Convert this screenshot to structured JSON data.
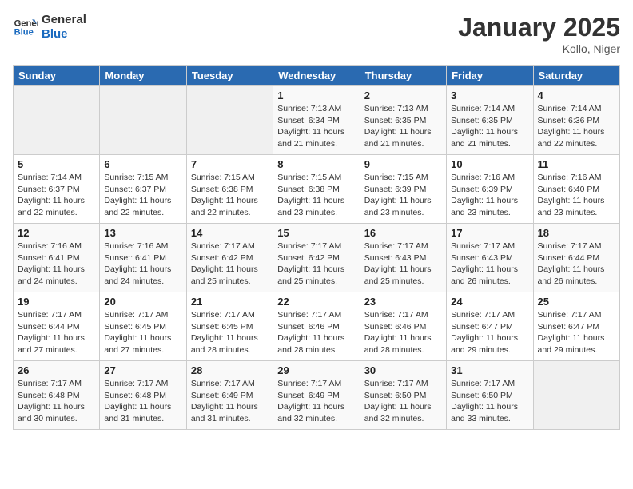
{
  "logo": {
    "line1": "General",
    "line2": "Blue"
  },
  "title": "January 2025",
  "subtitle": "Kollo, Niger",
  "weekdays": [
    "Sunday",
    "Monday",
    "Tuesday",
    "Wednesday",
    "Thursday",
    "Friday",
    "Saturday"
  ],
  "weeks": [
    [
      {
        "day": "",
        "info": ""
      },
      {
        "day": "",
        "info": ""
      },
      {
        "day": "",
        "info": ""
      },
      {
        "day": "1",
        "info": "Sunrise: 7:13 AM\nSunset: 6:34 PM\nDaylight: 11 hours\nand 21 minutes."
      },
      {
        "day": "2",
        "info": "Sunrise: 7:13 AM\nSunset: 6:35 PM\nDaylight: 11 hours\nand 21 minutes."
      },
      {
        "day": "3",
        "info": "Sunrise: 7:14 AM\nSunset: 6:35 PM\nDaylight: 11 hours\nand 21 minutes."
      },
      {
        "day": "4",
        "info": "Sunrise: 7:14 AM\nSunset: 6:36 PM\nDaylight: 11 hours\nand 22 minutes."
      }
    ],
    [
      {
        "day": "5",
        "info": "Sunrise: 7:14 AM\nSunset: 6:37 PM\nDaylight: 11 hours\nand 22 minutes."
      },
      {
        "day": "6",
        "info": "Sunrise: 7:15 AM\nSunset: 6:37 PM\nDaylight: 11 hours\nand 22 minutes."
      },
      {
        "day": "7",
        "info": "Sunrise: 7:15 AM\nSunset: 6:38 PM\nDaylight: 11 hours\nand 22 minutes."
      },
      {
        "day": "8",
        "info": "Sunrise: 7:15 AM\nSunset: 6:38 PM\nDaylight: 11 hours\nand 23 minutes."
      },
      {
        "day": "9",
        "info": "Sunrise: 7:15 AM\nSunset: 6:39 PM\nDaylight: 11 hours\nand 23 minutes."
      },
      {
        "day": "10",
        "info": "Sunrise: 7:16 AM\nSunset: 6:39 PM\nDaylight: 11 hours\nand 23 minutes."
      },
      {
        "day": "11",
        "info": "Sunrise: 7:16 AM\nSunset: 6:40 PM\nDaylight: 11 hours\nand 23 minutes."
      }
    ],
    [
      {
        "day": "12",
        "info": "Sunrise: 7:16 AM\nSunset: 6:41 PM\nDaylight: 11 hours\nand 24 minutes."
      },
      {
        "day": "13",
        "info": "Sunrise: 7:16 AM\nSunset: 6:41 PM\nDaylight: 11 hours\nand 24 minutes."
      },
      {
        "day": "14",
        "info": "Sunrise: 7:17 AM\nSunset: 6:42 PM\nDaylight: 11 hours\nand 25 minutes."
      },
      {
        "day": "15",
        "info": "Sunrise: 7:17 AM\nSunset: 6:42 PM\nDaylight: 11 hours\nand 25 minutes."
      },
      {
        "day": "16",
        "info": "Sunrise: 7:17 AM\nSunset: 6:43 PM\nDaylight: 11 hours\nand 25 minutes."
      },
      {
        "day": "17",
        "info": "Sunrise: 7:17 AM\nSunset: 6:43 PM\nDaylight: 11 hours\nand 26 minutes."
      },
      {
        "day": "18",
        "info": "Sunrise: 7:17 AM\nSunset: 6:44 PM\nDaylight: 11 hours\nand 26 minutes."
      }
    ],
    [
      {
        "day": "19",
        "info": "Sunrise: 7:17 AM\nSunset: 6:44 PM\nDaylight: 11 hours\nand 27 minutes."
      },
      {
        "day": "20",
        "info": "Sunrise: 7:17 AM\nSunset: 6:45 PM\nDaylight: 11 hours\nand 27 minutes."
      },
      {
        "day": "21",
        "info": "Sunrise: 7:17 AM\nSunset: 6:45 PM\nDaylight: 11 hours\nand 28 minutes."
      },
      {
        "day": "22",
        "info": "Sunrise: 7:17 AM\nSunset: 6:46 PM\nDaylight: 11 hours\nand 28 minutes."
      },
      {
        "day": "23",
        "info": "Sunrise: 7:17 AM\nSunset: 6:46 PM\nDaylight: 11 hours\nand 28 minutes."
      },
      {
        "day": "24",
        "info": "Sunrise: 7:17 AM\nSunset: 6:47 PM\nDaylight: 11 hours\nand 29 minutes."
      },
      {
        "day": "25",
        "info": "Sunrise: 7:17 AM\nSunset: 6:47 PM\nDaylight: 11 hours\nand 29 minutes."
      }
    ],
    [
      {
        "day": "26",
        "info": "Sunrise: 7:17 AM\nSunset: 6:48 PM\nDaylight: 11 hours\nand 30 minutes."
      },
      {
        "day": "27",
        "info": "Sunrise: 7:17 AM\nSunset: 6:48 PM\nDaylight: 11 hours\nand 31 minutes."
      },
      {
        "day": "28",
        "info": "Sunrise: 7:17 AM\nSunset: 6:49 PM\nDaylight: 11 hours\nand 31 minutes."
      },
      {
        "day": "29",
        "info": "Sunrise: 7:17 AM\nSunset: 6:49 PM\nDaylight: 11 hours\nand 32 minutes."
      },
      {
        "day": "30",
        "info": "Sunrise: 7:17 AM\nSunset: 6:50 PM\nDaylight: 11 hours\nand 32 minutes."
      },
      {
        "day": "31",
        "info": "Sunrise: 7:17 AM\nSunset: 6:50 PM\nDaylight: 11 hours\nand 33 minutes."
      },
      {
        "day": "",
        "info": ""
      }
    ]
  ]
}
